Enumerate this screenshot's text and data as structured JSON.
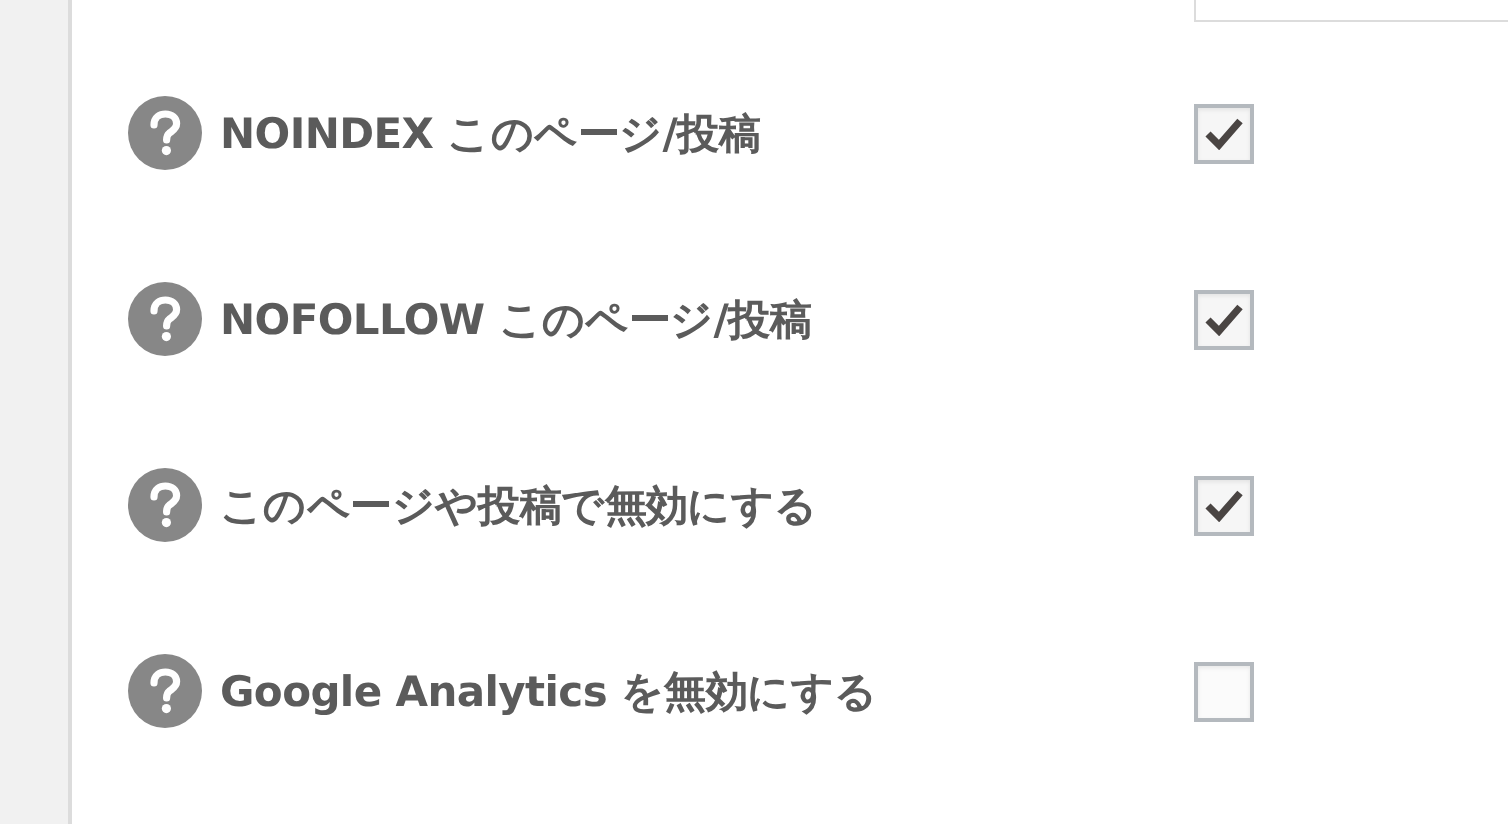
{
  "options": [
    {
      "label": "NOINDEX このページ/投稿",
      "checked": true
    },
    {
      "label": "NOFOLLOW このページ/投稿",
      "checked": true
    },
    {
      "label": "このページや投稿で無効にする",
      "checked": true
    },
    {
      "label": "Google Analytics を無効にする",
      "checked": false
    }
  ]
}
